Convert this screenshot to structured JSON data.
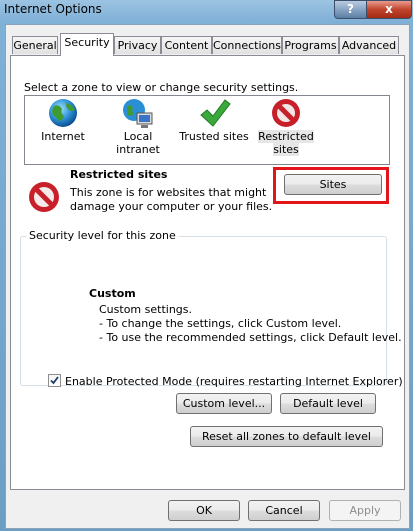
{
  "window": {
    "title": "Internet Options",
    "help_label": "?",
    "close_label": "x"
  },
  "tabs": [
    "General",
    "Security",
    "Privacy",
    "Content",
    "Connections",
    "Programs",
    "Advanced"
  ],
  "active_tab": "Security",
  "zone_prompt": "Select a zone to view or change security settings.",
  "zones": [
    {
      "label": "Internet",
      "icon": "globe-icon"
    },
    {
      "label": "Local intranet",
      "icon": "intranet-icon"
    },
    {
      "label": "Trusted sites",
      "icon": "checkmark-icon"
    },
    {
      "label": "Restricted sites",
      "label_line1": "Restricted",
      "label_line2": "sites",
      "icon": "restricted-icon",
      "selected": true
    }
  ],
  "zone_info": {
    "title": "Restricted sites",
    "description_line1": "This zone is for websites that might",
    "description_line2": "damage your computer or your files.",
    "sites_button": "Sites"
  },
  "security_level": {
    "group_label": "Security level for this zone",
    "level_title": "Custom",
    "lines": [
      "Custom settings.",
      "- To change the settings, click Custom level.",
      "- To use the recommended settings, click Default level."
    ],
    "protected_mode_label": "Enable Protected Mode (requires restarting Internet Explorer)",
    "protected_mode_checked": true,
    "custom_level_button": "Custom level...",
    "default_level_button": "Default level"
  },
  "reset_all_button": "Reset all zones to default level",
  "footer": {
    "ok": "OK",
    "cancel": "Cancel",
    "apply": "Apply"
  },
  "colors": {
    "highlight_border": "#e3151a",
    "restricted_red": "#c8202a",
    "trusted_green": "#3aa83a"
  }
}
